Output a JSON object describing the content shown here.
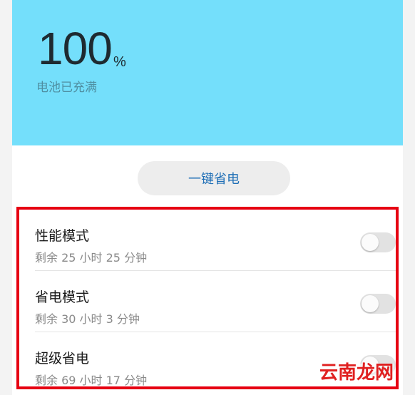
{
  "battery": {
    "percent": "100",
    "percent_sign": "%",
    "status": "电池已充满"
  },
  "actions": {
    "one_key_save": "一键省电"
  },
  "modes": [
    {
      "title": "性能模式",
      "remaining": "剩余 25 小时 25 分钟",
      "enabled": false
    },
    {
      "title": "省电模式",
      "remaining": "剩余 30 小时 3 分钟",
      "enabled": false
    },
    {
      "title": "超级省电",
      "remaining": "剩余 69 小时 17 分钟",
      "enabled": false
    }
  ],
  "watermark": "云南龙网",
  "colors": {
    "header_bg": "#74dffb",
    "highlight_border": "#e60012",
    "button_text": "#1f6fb6"
  }
}
